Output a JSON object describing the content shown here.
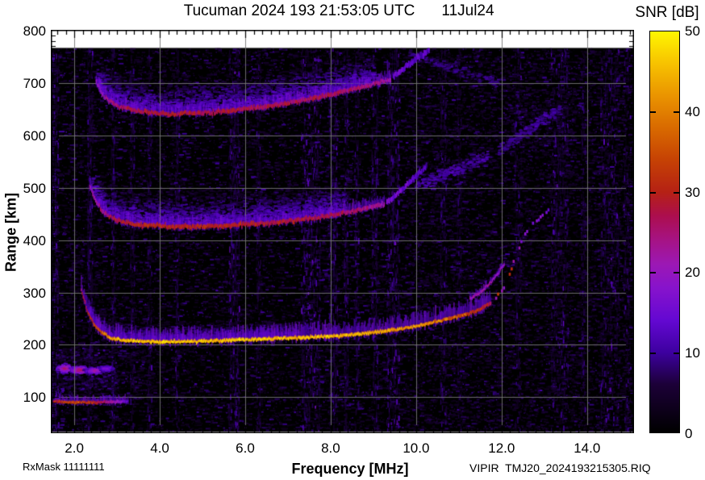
{
  "title": {
    "text": "Tucuman 2024 193 21:53:05 UTC",
    "date": "11Jul24"
  },
  "footer": {
    "rx_mask": "RxMask 11111111",
    "file": "VIPIR  TMJ20_2024193215305.RIQ"
  },
  "colorbar": {
    "title": "SNR [dB]",
    "min": 0,
    "max": 50,
    "tick_labels": [
      {
        "v": 0,
        "label": "0"
      },
      {
        "v": 10,
        "label": "10"
      },
      {
        "v": 20,
        "label": "20"
      },
      {
        "v": 30,
        "label": "30"
      },
      {
        "v": 40,
        "label": "40"
      },
      {
        "v": 50,
        "label": "50"
      }
    ],
    "tick_marks": [
      10,
      20,
      30,
      40
    ],
    "gradient_stops": [
      [
        0,
        "#000000"
      ],
      [
        6,
        "#1c0038"
      ],
      [
        10,
        "#3d00a0"
      ],
      [
        14,
        "#6408d2"
      ],
      [
        18,
        "#8713cc"
      ],
      [
        21,
        "#9c18b4"
      ],
      [
        24,
        "#a61384"
      ],
      [
        27,
        "#ac0e4e"
      ],
      [
        30,
        "#b52114"
      ],
      [
        34,
        "#c64204"
      ],
      [
        38,
        "#d96a00"
      ],
      [
        42,
        "#ea9400"
      ],
      [
        46,
        "#f7c200"
      ],
      [
        50,
        "#fff600"
      ]
    ]
  },
  "axes": {
    "x": {
      "label": "Frequency [MHz]",
      "min": 1.45,
      "max": 15.1,
      "ticks": [
        {
          "v": 2,
          "label": "2.0"
        },
        {
          "v": 4,
          "label": "4.0"
        },
        {
          "v": 6,
          "label": "6.0"
        },
        {
          "v": 8,
          "label": "8.0"
        },
        {
          "v": 10,
          "label": "10.0"
        },
        {
          "v": 12,
          "label": "12.0"
        },
        {
          "v": 14,
          "label": "14.0"
        }
      ],
      "minor_step": 0.2
    },
    "y": {
      "label": "Range [km]",
      "min": 32,
      "max": 800,
      "ticks": [
        {
          "v": 100,
          "label": "100"
        },
        {
          "v": 200,
          "label": "200"
        },
        {
          "v": 300,
          "label": "300"
        },
        {
          "v": 400,
          "label": "400"
        },
        {
          "v": 500,
          "label": "500"
        },
        {
          "v": 600,
          "label": "600"
        },
        {
          "v": 700,
          "label": "700"
        },
        {
          "v": 800,
          "label": "800"
        }
      ],
      "minor_step": 10
    }
  },
  "chart_data": {
    "type": "heatmap",
    "title": "Tucuman 2024 193 21:53:05 UTC",
    "xlabel": "Frequency [MHz]",
    "ylabel": "Range [km]",
    "zlabel": "SNR [dB]",
    "x_range": [
      1.45,
      15.1
    ],
    "y_range": [
      32,
      800
    ],
    "z_range": [
      0,
      50
    ],
    "data_top_km": 767,
    "gridlines": {
      "x": [
        2,
        4,
        6,
        8,
        10,
        12,
        14
      ],
      "y": [
        100,
        200,
        300,
        400,
        500,
        600,
        700
      ]
    },
    "traces": [
      {
        "name": "F-trace 1-hop main",
        "style": "solid",
        "core_km": 6,
        "halo_km": 22,
        "jitter_km": 2,
        "points": [
          [
            2.15,
            305
          ],
          [
            2.3,
            262
          ],
          [
            2.5,
            232
          ],
          [
            2.8,
            214
          ],
          [
            3.2,
            208
          ],
          [
            4,
            206
          ],
          [
            5,
            207
          ],
          [
            6,
            210
          ],
          [
            7,
            213
          ],
          [
            8,
            216
          ],
          [
            8.7,
            221
          ],
          [
            9.3,
            227
          ],
          [
            10,
            235
          ],
          [
            10.5,
            245
          ],
          [
            11,
            255
          ],
          [
            11.4,
            265
          ],
          [
            11.75,
            280
          ]
        ],
        "snr": [
          [
            2.15,
            26
          ],
          [
            2.5,
            34
          ],
          [
            3,
            42
          ],
          [
            4,
            44
          ],
          [
            5,
            43
          ],
          [
            6,
            44
          ],
          [
            7,
            42
          ],
          [
            8,
            43
          ],
          [
            9,
            41
          ],
          [
            10,
            39
          ],
          [
            10.8,
            36
          ],
          [
            11.4,
            32
          ],
          [
            11.75,
            27
          ]
        ]
      },
      {
        "name": "F-trace x-branch split",
        "style": "solid",
        "core_km": 5,
        "halo_km": 8,
        "jitter_km": 2,
        "points": [
          [
            11.25,
            288
          ],
          [
            11.5,
            300
          ],
          [
            11.7,
            316
          ],
          [
            11.9,
            336
          ],
          [
            12.05,
            355
          ]
        ],
        "snr": [
          [
            11.25,
            21
          ],
          [
            11.7,
            22
          ],
          [
            12.05,
            18
          ]
        ]
      },
      {
        "name": "F-trace asymptote riser",
        "style": "dotted",
        "core_km": 7,
        "halo_km": 6,
        "jitter_km": 3,
        "points": [
          [
            11.85,
            292
          ],
          [
            12.0,
            302
          ],
          [
            12.1,
            320
          ],
          [
            12.2,
            344
          ],
          [
            12.3,
            368
          ],
          [
            12.45,
            398
          ],
          [
            12.6,
            420
          ],
          [
            12.8,
            438
          ],
          [
            13.0,
            452
          ],
          [
            13.12,
            461
          ]
        ],
        "snr": [
          [
            11.85,
            22
          ],
          [
            12.2,
            21
          ],
          [
            12.5,
            19
          ],
          [
            13.12,
            15
          ]
        ]
      },
      {
        "name": "F-trace 2-hop",
        "style": "solid",
        "core_km": 7,
        "halo_km": 16,
        "jitter_km": 3,
        "points": [
          [
            2.35,
            505
          ],
          [
            2.5,
            472
          ],
          [
            2.7,
            450
          ],
          [
            3.0,
            437
          ],
          [
            3.5,
            429
          ],
          [
            4.5,
            425
          ],
          [
            5.5,
            427
          ],
          [
            6.5,
            432
          ],
          [
            7.5,
            441
          ],
          [
            8.2,
            450
          ],
          [
            8.8,
            460
          ],
          [
            9.25,
            469
          ]
        ],
        "snr": [
          [
            2.35,
            20
          ],
          [
            2.8,
            27
          ],
          [
            3.5,
            31
          ],
          [
            5,
            30
          ],
          [
            6.5,
            29
          ],
          [
            7.5,
            28
          ],
          [
            8.4,
            26
          ],
          [
            9.25,
            22
          ]
        ]
      },
      {
        "name": "F-trace 2-hop faded extension",
        "style": "solid",
        "core_km": 9,
        "halo_km": 6,
        "jitter_km": 3,
        "points": [
          [
            9.3,
            472
          ],
          [
            9.6,
            492
          ],
          [
            9.9,
            516
          ],
          [
            10.25,
            542
          ]
        ],
        "snr": [
          [
            9.3,
            17
          ],
          [
            10.25,
            12
          ]
        ]
      },
      {
        "name": "F-trace 3-hop",
        "style": "solid",
        "core_km": 7,
        "halo_km": 16,
        "jitter_km": 3,
        "points": [
          [
            2.5,
            700
          ],
          [
            2.7,
            672
          ],
          [
            3.0,
            656
          ],
          [
            3.5,
            646
          ],
          [
            4.2,
            641
          ],
          [
            5,
            643
          ],
          [
            5.7,
            648
          ],
          [
            6.5,
            656
          ],
          [
            7.2,
            665
          ],
          [
            8,
            678
          ],
          [
            8.6,
            690
          ],
          [
            9.1,
            700
          ],
          [
            9.4,
            708
          ]
        ],
        "snr": [
          [
            2.5,
            18
          ],
          [
            3,
            26
          ],
          [
            4,
            29
          ],
          [
            5,
            28
          ],
          [
            6,
            27
          ],
          [
            7,
            27
          ],
          [
            8,
            26
          ],
          [
            8.8,
            25
          ],
          [
            9.4,
            22
          ]
        ]
      },
      {
        "name": "F-trace 3-hop faded extension",
        "style": "solid",
        "core_km": 9,
        "halo_km": 6,
        "jitter_km": 3,
        "points": [
          [
            9.45,
            712
          ],
          [
            9.7,
            727
          ],
          [
            10.0,
            747
          ],
          [
            10.3,
            763
          ]
        ],
        "snr": [
          [
            9.45,
            16
          ],
          [
            10.3,
            12
          ]
        ]
      },
      {
        "name": "E-region flat echo 90 km",
        "style": "solid",
        "core_km": 5,
        "halo_km": 11,
        "jitter_km": 1.5,
        "points": [
          [
            1.5,
            92
          ],
          [
            1.9,
            90
          ],
          [
            2.4,
            90
          ],
          [
            2.9,
            91
          ],
          [
            3.25,
            92
          ]
        ],
        "snr": [
          [
            1.5,
            29
          ],
          [
            1.9,
            34
          ],
          [
            2.4,
            32
          ],
          [
            2.8,
            24
          ],
          [
            3.25,
            14
          ]
        ]
      }
    ],
    "clouds": [
      {
        "name": "spread above 1-hop",
        "base_trace": 0,
        "f": [
          2.3,
          7.2
        ],
        "up_km": 26,
        "snr": 12,
        "density": 0.9
      },
      {
        "name": "spread above 2-hop",
        "base_trace": 3,
        "f": [
          2.4,
          8.3
        ],
        "up_km": 52,
        "snr": 14,
        "density": 1.15
      },
      {
        "name": "spread above 3-hop",
        "base_trace": 5,
        "f": [
          2.5,
          9.0
        ],
        "up_km": 52,
        "snr": 14,
        "density": 1.15
      }
    ],
    "blobs": [
      {
        "f": 1.75,
        "r": 156,
        "fw": 0.18,
        "rh": 8,
        "snr": 26
      },
      {
        "f": 2.1,
        "r": 153,
        "fw": 0.18,
        "rh": 7,
        "snr": 29
      },
      {
        "f": 2.45,
        "r": 152,
        "fw": 0.2,
        "rh": 6,
        "snr": 24
      },
      {
        "f": 2.72,
        "r": 156,
        "fw": 0.15,
        "rh": 5,
        "snr": 20
      }
    ],
    "box_fuzz": [
      {
        "f": [
          1.55,
          3.6
        ],
        "r": [
          95,
          200
        ],
        "snr": 10,
        "density": 1.2
      },
      {
        "f": [
          1.6,
          3.0
        ],
        "r": [
          116,
          142
        ],
        "snr": 13,
        "density": 1.6
      },
      {
        "f": [
          1.55,
          2.75
        ],
        "r": [
          168,
          194
        ],
        "snr": 12,
        "density": 1.5
      },
      {
        "f": [
          1.55,
          2.7
        ],
        "r": [
          250,
          410
        ],
        "snr": 7,
        "density": 0.45
      },
      {
        "f": [
          9.7,
          15.05
        ],
        "r": [
          40,
          760
        ],
        "snr": 7,
        "density": 0.4
      },
      {
        "f": [
          12.2,
          13.7
        ],
        "r": [
          580,
          690
        ],
        "snr": 9,
        "density": 0.7
      },
      {
        "f": [
          9.9,
          11.8
        ],
        "r": [
          490,
          575
        ],
        "snr": 8,
        "density": 0.5
      }
    ],
    "spread_echoes": [
      {
        "points": [
          [
            9.95,
            505
          ],
          [
            10.8,
            532
          ],
          [
            11.65,
            562
          ]
        ],
        "width_km": 22,
        "snr": 11,
        "density": 1.0
      },
      {
        "points": [
          [
            11.9,
            572
          ],
          [
            12.6,
            612
          ],
          [
            13.35,
            655
          ]
        ],
        "width_km": 20,
        "snr": 10,
        "density": 0.9
      },
      {
        "points": [
          [
            9.8,
            758
          ],
          [
            10.9,
            727
          ],
          [
            11.9,
            700
          ]
        ],
        "width_km": 16,
        "snr": 9,
        "density": 0.7
      }
    ],
    "rfi_columns": [
      {
        "f": [
          1.45,
          1.62
        ],
        "snr": 12,
        "density": 0.7
      },
      {
        "f": [
          2.3,
          2.42
        ],
        "snr": 12,
        "density": 0.5
      },
      {
        "f": [
          2.85,
          2.95
        ],
        "snr": 11,
        "density": 0.4
      },
      {
        "f": [
          3.3,
          3.4
        ],
        "snr": 10,
        "density": 0.35
      },
      {
        "f": [
          3.7,
          3.8
        ],
        "snr": 10,
        "density": 0.3
      },
      {
        "f": [
          4.35,
          4.45
        ],
        "snr": 11,
        "density": 0.35
      },
      {
        "f": [
          5.6,
          5.85
        ],
        "snr": 14,
        "density": 0.85
      },
      {
        "f": [
          6.25,
          6.35
        ],
        "snr": 10,
        "density": 0.3
      },
      {
        "f": [
          7.3,
          7.75
        ],
        "snr": 15,
        "density": 1.0
      },
      {
        "f": [
          7.95,
          8.15
        ],
        "snr": 13,
        "density": 0.6
      },
      {
        "f": [
          8.3,
          8.4
        ],
        "snr": 11,
        "density": 0.35
      },
      {
        "f": [
          8.55,
          8.65
        ],
        "snr": 11,
        "density": 0.3
      },
      {
        "f": [
          8.95,
          9.1
        ],
        "snr": 12,
        "density": 0.5
      },
      {
        "f": [
          9.3,
          9.6
        ],
        "snr": 14,
        "density": 0.9
      },
      {
        "f": [
          10.55,
          10.7
        ],
        "snr": 11,
        "density": 0.4
      },
      {
        "f": [
          10.95,
          11.05
        ],
        "snr": 10,
        "density": 0.3
      },
      {
        "f": [
          12.3,
          12.45
        ],
        "snr": 11,
        "density": 0.35
      },
      {
        "f": [
          13.15,
          13.55
        ],
        "snr": 13,
        "density": 0.8
      },
      {
        "f": [
          13.85,
          13.95
        ],
        "snr": 10,
        "density": 0.3
      },
      {
        "f": [
          14.3,
          14.75
        ],
        "snr": 13,
        "density": 0.8
      },
      {
        "f": [
          14.85,
          15.02
        ],
        "snr": 11,
        "density": 0.4
      }
    ],
    "noise": {
      "dash_count": 12000,
      "dot_count": 9000,
      "snr_max": 12
    }
  }
}
